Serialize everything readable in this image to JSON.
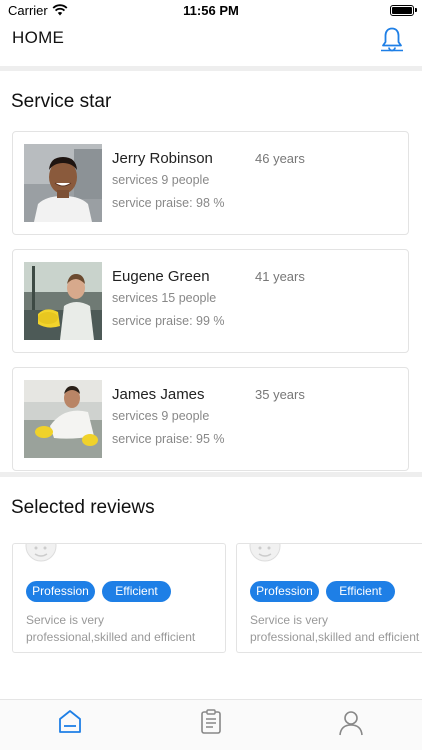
{
  "status_bar": {
    "carrier": "Carrier",
    "time": "11:56 PM"
  },
  "header": {
    "title": "HOME",
    "bell_icon": "bell-icon",
    "accent_color": "#1e7fe6"
  },
  "service_star": {
    "title": "Service star",
    "people": [
      {
        "name": "Jerry Robinson",
        "age": "46 years",
        "served": "services 9 people",
        "praise": "service praise: 98 %"
      },
      {
        "name": "Eugene Green",
        "age": "41 years",
        "served": "services 15 people",
        "praise": "service praise: 99 %"
      },
      {
        "name": "James James",
        "age": "35 years",
        "served": "services 9 people",
        "praise": "service praise: 95 %"
      }
    ]
  },
  "selected_reviews": {
    "title": "Selected reviews",
    "reviews": [
      {
        "tags": [
          "Profession",
          "Efficient"
        ],
        "line1": "Service is very",
        "line2": "professional,skilled and efficient"
      },
      {
        "tags": [
          "Profession",
          "Efficient"
        ],
        "line1": "Service is very",
        "line2": "professional,skilled and efficient"
      }
    ]
  },
  "tab_bar": {
    "tabs": [
      {
        "icon": "home-icon",
        "active": true
      },
      {
        "icon": "clipboard-icon",
        "active": false
      },
      {
        "icon": "user-icon",
        "active": false
      }
    ]
  }
}
